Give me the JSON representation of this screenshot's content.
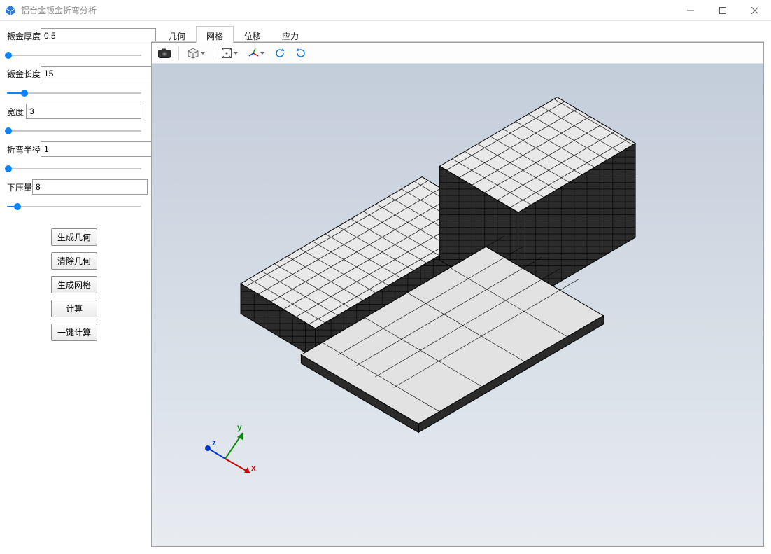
{
  "window": {
    "title": "铝合金钣金折弯分析"
  },
  "parameters": [
    {
      "label": "钣金厚度",
      "value": "0.5",
      "fill_pct": 1,
      "thumb_pct": 1
    },
    {
      "label": "钣金长度",
      "value": "15",
      "fill_pct": 13,
      "thumb_pct": 13
    },
    {
      "label": "宽度",
      "value": "3",
      "fill_pct": 1,
      "thumb_pct": 1
    },
    {
      "label": "折弯半径",
      "value": "1",
      "fill_pct": 1,
      "thumb_pct": 1
    },
    {
      "label": "下压量",
      "value": "8",
      "fill_pct": 8,
      "thumb_pct": 8
    }
  ],
  "buttons": {
    "generate_geometry": "生成几何",
    "clear_geometry": "清除几何",
    "generate_mesh": "生成网格",
    "compute": "计算",
    "one_click_compute": "一键计算"
  },
  "tabs": [
    {
      "id": "geometry",
      "label": "几何"
    },
    {
      "id": "mesh",
      "label": "网格"
    },
    {
      "id": "displacement",
      "label": "位移"
    },
    {
      "id": "stress",
      "label": "应力"
    }
  ],
  "active_tab": "mesh",
  "toolbar_icons": [
    "screenshot-icon",
    "view-cube-icon",
    "zoom-extents-icon",
    "orbit-axes-icon",
    "rotate-ccw-icon",
    "rotate-cw-icon"
  ],
  "axis_triad": {
    "x": "x",
    "y": "y",
    "z": "z"
  }
}
